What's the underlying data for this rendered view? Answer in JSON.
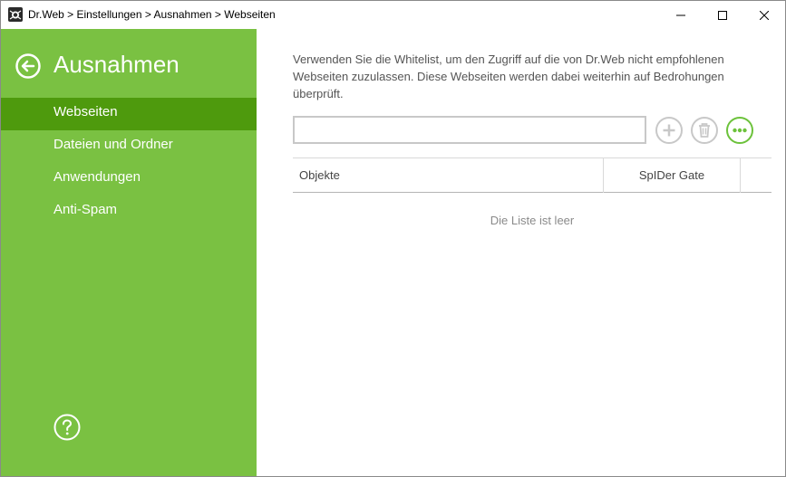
{
  "window": {
    "title": "Dr.Web > Einstellungen > Ausnahmen > Webseiten",
    "app_icon": "drweb-spider-icon",
    "controls": [
      "minimize-icon",
      "maximize-icon",
      "close-icon"
    ]
  },
  "sidebar": {
    "title": "Ausnahmen",
    "back_icon": "back-arrow-icon",
    "help_icon": "help-icon",
    "items": [
      {
        "label": "Webseiten",
        "active": true
      },
      {
        "label": "Dateien und Ordner",
        "active": false
      },
      {
        "label": "Anwendungen",
        "active": false
      },
      {
        "label": "Anti-Spam",
        "active": false
      }
    ]
  },
  "main": {
    "description": "Verwenden Sie die Whitelist, um den Zugriff auf die von Dr.Web nicht empfohlenen Webseiten zuzulassen. Diese Webseiten werden dabei weiterhin auf Bedrohungen überprüft.",
    "input": {
      "value": "",
      "placeholder": ""
    },
    "table": {
      "columns": [
        "Objekte",
        "SpIDer Gate"
      ],
      "rows": [],
      "empty_text": "Die Liste ist leer"
    }
  },
  "colors": {
    "sidebar_bg": "#7ac142",
    "sidebar_active": "#4e9a0d",
    "accent_green": "#6cc23b",
    "disabled_gray": "#c8c8c8"
  }
}
